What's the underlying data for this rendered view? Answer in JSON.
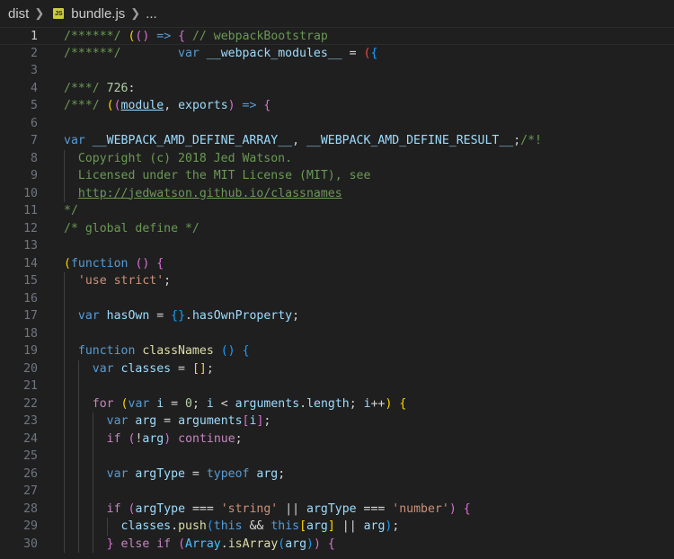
{
  "breadcrumb": {
    "folder": "dist",
    "file": "bundle.js",
    "ellipsis": "...",
    "file_icon": "JS"
  },
  "lines": [
    {
      "n": "1",
      "tokens": [
        [
          "/******/ ",
          "c-com"
        ],
        [
          "(",
          "c-p1"
        ],
        [
          "(",
          "c-p2"
        ],
        [
          ")",
          "c-p2"
        ],
        [
          " => ",
          "c-kw"
        ],
        [
          "{",
          "c-p2"
        ],
        [
          " // webpackBootstrap",
          "c-com"
        ]
      ]
    },
    {
      "n": "2",
      "tokens": [
        [
          "/******/ ",
          "c-com"
        ],
        [
          "\tvar ",
          "c-kw"
        ],
        [
          "__webpack_modules__",
          "c-var"
        ],
        [
          " = ",
          "c-op"
        ],
        [
          "(",
          "c-red"
        ],
        [
          "{",
          "c-p3"
        ]
      ]
    },
    {
      "n": "3",
      "tokens": []
    },
    {
      "n": "4",
      "tokens": [
        [
          "/***/ ",
          "c-com"
        ],
        [
          "726",
          "c-num"
        ],
        [
          ":",
          "c-op"
        ]
      ]
    },
    {
      "n": "5",
      "tokens": [
        [
          "/***/ ",
          "c-com"
        ],
        [
          "(",
          "c-p1"
        ],
        [
          "(",
          "c-p2"
        ],
        [
          "module",
          "c-var u"
        ],
        [
          ", ",
          "c-op"
        ],
        [
          "exports",
          "c-var"
        ],
        [
          ")",
          "c-p2"
        ],
        [
          " => ",
          "c-kw"
        ],
        [
          "{",
          "c-p2"
        ]
      ]
    },
    {
      "n": "6",
      "tokens": []
    },
    {
      "n": "7",
      "tokens": [
        [
          "var ",
          "c-kw"
        ],
        [
          "__WEBPACK_AMD_DEFINE_ARRAY__",
          "c-var"
        ],
        [
          ", ",
          "c-op"
        ],
        [
          "__WEBPACK_AMD_DEFINE_RESULT__",
          "c-var"
        ],
        [
          ";",
          "c-op"
        ],
        [
          "/*!",
          "c-com"
        ]
      ]
    },
    {
      "n": "8",
      "tokens": [
        [
          "  Copyright (c) 2018 Jed Watson.",
          "c-com"
        ]
      ]
    },
    {
      "n": "9",
      "tokens": [
        [
          "  Licensed under the MIT License (MIT), see",
          "c-com"
        ]
      ]
    },
    {
      "n": "10",
      "tokens": [
        [
          "  ",
          "c-com"
        ],
        [
          "http://jedwatson.github.io/classnames",
          "c-com u"
        ]
      ]
    },
    {
      "n": "11",
      "tokens": [
        [
          "*/",
          "c-com"
        ]
      ]
    },
    {
      "n": "12",
      "tokens": [
        [
          "/* global define */",
          "c-com"
        ]
      ]
    },
    {
      "n": "13",
      "tokens": []
    },
    {
      "n": "14",
      "tokens": [
        [
          "(",
          "c-p1"
        ],
        [
          "function",
          "c-kw"
        ],
        [
          " ",
          "c-op"
        ],
        [
          "()",
          "c-p2"
        ],
        [
          " ",
          "c-op"
        ],
        [
          "{",
          "c-p2"
        ]
      ]
    },
    {
      "n": "15",
      "tokens": [
        [
          "  ",
          "c-op"
        ],
        [
          "'use strict'",
          "c-str"
        ],
        [
          ";",
          "c-op"
        ]
      ]
    },
    {
      "n": "16",
      "tokens": []
    },
    {
      "n": "17",
      "tokens": [
        [
          "  ",
          "c-op"
        ],
        [
          "var ",
          "c-kw"
        ],
        [
          "hasOwn",
          "c-var"
        ],
        [
          " = ",
          "c-op"
        ],
        [
          "{}",
          "c-p3"
        ],
        [
          ".",
          "c-op"
        ],
        [
          "hasOwnProperty",
          "c-var"
        ],
        [
          ";",
          "c-op"
        ]
      ]
    },
    {
      "n": "18",
      "tokens": []
    },
    {
      "n": "19",
      "tokens": [
        [
          "  ",
          "c-op"
        ],
        [
          "function ",
          "c-kw"
        ],
        [
          "classNames",
          "c-fn"
        ],
        [
          " ",
          "c-op"
        ],
        [
          "()",
          "c-p3"
        ],
        [
          " ",
          "c-op"
        ],
        [
          "{",
          "c-p3"
        ]
      ]
    },
    {
      "n": "20",
      "tokens": [
        [
          "    ",
          "c-op"
        ],
        [
          "var ",
          "c-kw"
        ],
        [
          "classes",
          "c-var"
        ],
        [
          " = ",
          "c-op"
        ],
        [
          "[]",
          "c-p1"
        ],
        [
          ";",
          "c-op"
        ]
      ]
    },
    {
      "n": "21",
      "tokens": []
    },
    {
      "n": "22",
      "tokens": [
        [
          "    ",
          "c-op"
        ],
        [
          "for",
          "c-ctl"
        ],
        [
          " ",
          "c-op"
        ],
        [
          "(",
          "c-p1"
        ],
        [
          "var ",
          "c-kw"
        ],
        [
          "i",
          "c-var"
        ],
        [
          " = ",
          "c-op"
        ],
        [
          "0",
          "c-num"
        ],
        [
          "; ",
          "c-op"
        ],
        [
          "i",
          "c-var"
        ],
        [
          " < ",
          "c-op"
        ],
        [
          "arguments",
          "c-var"
        ],
        [
          ".",
          "c-op"
        ],
        [
          "length",
          "c-var"
        ],
        [
          "; ",
          "c-op"
        ],
        [
          "i",
          "c-var"
        ],
        [
          "++",
          "c-op"
        ],
        [
          ")",
          "c-p1"
        ],
        [
          " ",
          "c-op"
        ],
        [
          "{",
          "c-p1"
        ]
      ]
    },
    {
      "n": "23",
      "tokens": [
        [
          "      ",
          "c-op"
        ],
        [
          "var ",
          "c-kw"
        ],
        [
          "arg",
          "c-var"
        ],
        [
          " = ",
          "c-op"
        ],
        [
          "arguments",
          "c-var"
        ],
        [
          "[",
          "c-p2"
        ],
        [
          "i",
          "c-var"
        ],
        [
          "]",
          "c-p2"
        ],
        [
          ";",
          "c-op"
        ]
      ]
    },
    {
      "n": "24",
      "tokens": [
        [
          "      ",
          "c-op"
        ],
        [
          "if",
          "c-ctl"
        ],
        [
          " ",
          "c-op"
        ],
        [
          "(",
          "c-p2"
        ],
        [
          "!",
          "c-op"
        ],
        [
          "arg",
          "c-var"
        ],
        [
          ")",
          "c-p2"
        ],
        [
          " ",
          "c-op"
        ],
        [
          "continue",
          "c-ctl"
        ],
        [
          ";",
          "c-op"
        ]
      ]
    },
    {
      "n": "25",
      "tokens": []
    },
    {
      "n": "26",
      "tokens": [
        [
          "      ",
          "c-op"
        ],
        [
          "var ",
          "c-kw"
        ],
        [
          "argType",
          "c-var"
        ],
        [
          " = ",
          "c-op"
        ],
        [
          "typeof ",
          "c-kw"
        ],
        [
          "arg",
          "c-var"
        ],
        [
          ";",
          "c-op"
        ]
      ]
    },
    {
      "n": "27",
      "tokens": []
    },
    {
      "n": "28",
      "tokens": [
        [
          "      ",
          "c-op"
        ],
        [
          "if",
          "c-ctl"
        ],
        [
          " ",
          "c-op"
        ],
        [
          "(",
          "c-p2"
        ],
        [
          "argType",
          "c-var"
        ],
        [
          " === ",
          "c-op"
        ],
        [
          "'string'",
          "c-str"
        ],
        [
          " || ",
          "c-op"
        ],
        [
          "argType",
          "c-var"
        ],
        [
          " === ",
          "c-op"
        ],
        [
          "'number'",
          "c-str"
        ],
        [
          ")",
          "c-p2"
        ],
        [
          " ",
          "c-op"
        ],
        [
          "{",
          "c-p2"
        ]
      ]
    },
    {
      "n": "29",
      "tokens": [
        [
          "        ",
          "c-op"
        ],
        [
          "classes",
          "c-var"
        ],
        [
          ".",
          "c-op"
        ],
        [
          "push",
          "c-fn"
        ],
        [
          "(",
          "c-p3"
        ],
        [
          "this",
          "c-kw"
        ],
        [
          " && ",
          "c-op"
        ],
        [
          "this",
          "c-kw"
        ],
        [
          "[",
          "c-p1"
        ],
        [
          "arg",
          "c-var"
        ],
        [
          "]",
          "c-p1"
        ],
        [
          " || ",
          "c-op"
        ],
        [
          "arg",
          "c-var"
        ],
        [
          ")",
          "c-p3"
        ],
        [
          ";",
          "c-op"
        ]
      ]
    },
    {
      "n": "30",
      "tokens": [
        [
          "      ",
          "c-op"
        ],
        [
          "}",
          "c-p2"
        ],
        [
          " else ",
          "c-ctl"
        ],
        [
          "if",
          "c-ctl"
        ],
        [
          " ",
          "c-op"
        ],
        [
          "(",
          "c-p2"
        ],
        [
          "Array",
          "c-cst"
        ],
        [
          ".",
          "c-op"
        ],
        [
          "isArray",
          "c-fn"
        ],
        [
          "(",
          "c-p3"
        ],
        [
          "arg",
          "c-var"
        ],
        [
          ")",
          "c-p3"
        ],
        [
          ")",
          "c-p2"
        ],
        [
          " ",
          "c-op"
        ],
        [
          "{",
          "c-p2"
        ]
      ]
    }
  ]
}
